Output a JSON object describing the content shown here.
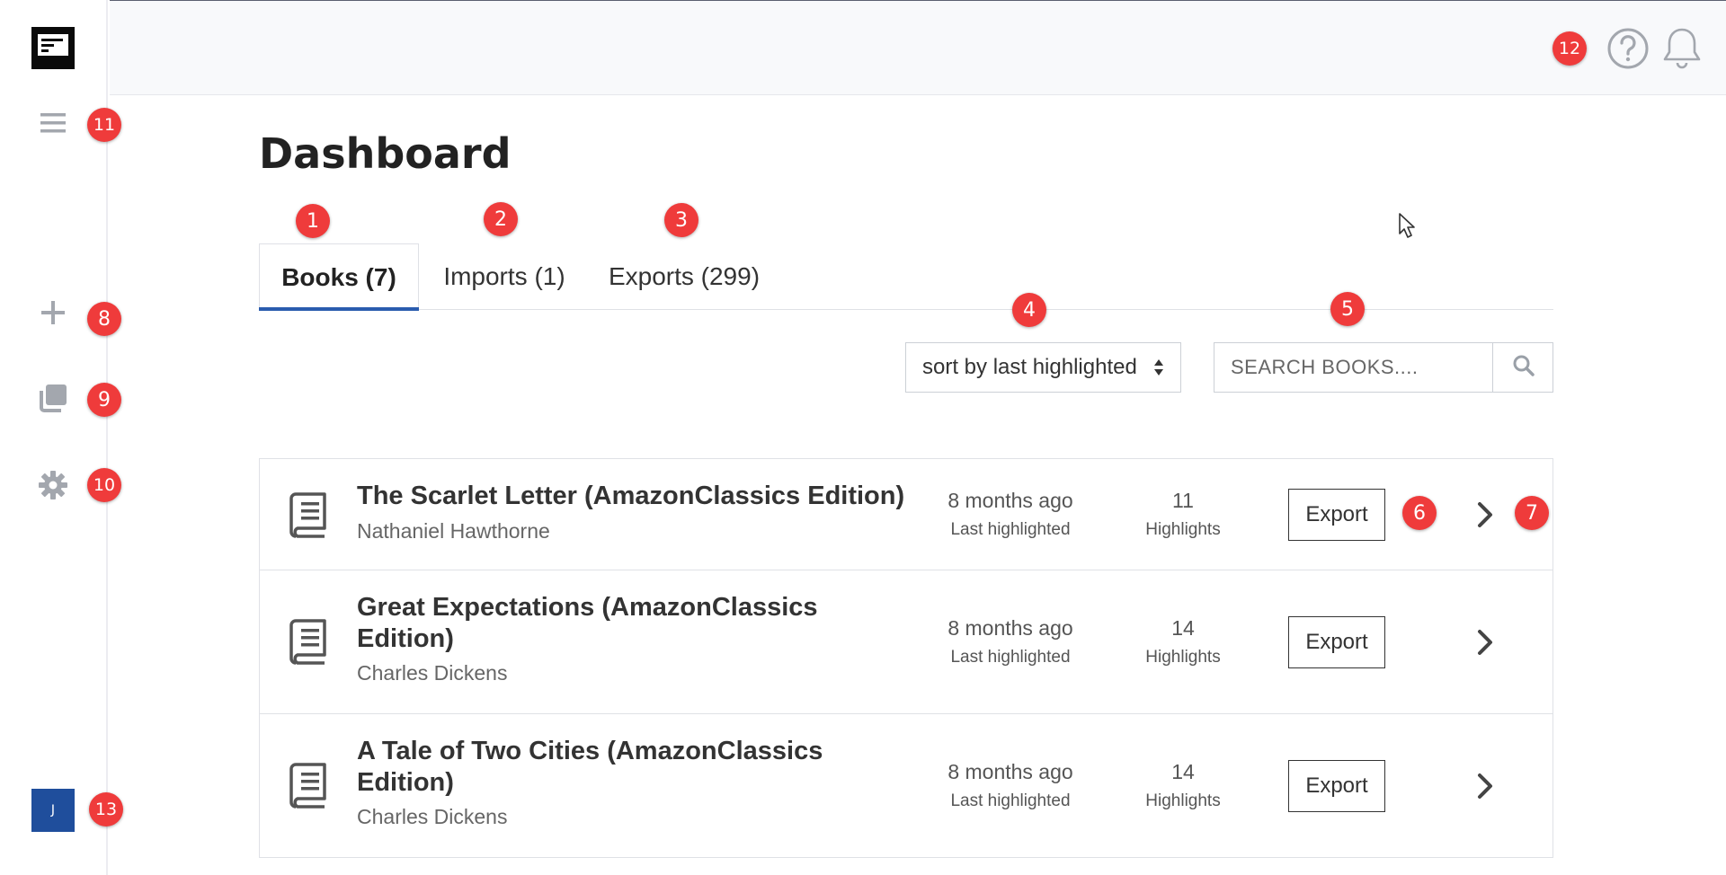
{
  "app": {
    "page_title": "Dashboard",
    "avatar_initial": "J"
  },
  "sidebar": {
    "items": [
      {
        "icon": "menu-icon"
      },
      {
        "icon": "plus-icon"
      },
      {
        "icon": "copy-icon"
      },
      {
        "icon": "gear-icon"
      }
    ]
  },
  "header": {
    "icons": [
      "help-icon",
      "bell-icon"
    ]
  },
  "tabs": [
    {
      "label": "Books (7)",
      "active": true
    },
    {
      "label": "Imports (1)",
      "active": false
    },
    {
      "label": "Exports (299)",
      "active": false
    }
  ],
  "controls": {
    "sort_label": "sort by last highlighted",
    "search_placeholder": "SEARCH BOOKS...."
  },
  "books": [
    {
      "title": "The Scarlet Letter (AmazonClassics Edition)",
      "author": "Nathaniel Hawthorne",
      "last_highlighted": "8 months ago",
      "last_highlighted_label": "Last highlighted",
      "highlights": "11",
      "highlights_label": "Highlights",
      "export_label": "Export"
    },
    {
      "title": "Great Expectations (AmazonClassics Edition)",
      "author": "Charles Dickens",
      "last_highlighted": "8 months ago",
      "last_highlighted_label": "Last highlighted",
      "highlights": "14",
      "highlights_label": "Highlights",
      "export_label": "Export"
    },
    {
      "title": "A Tale of Two Cities (AmazonClassics Edition)",
      "author": "Charles Dickens",
      "last_highlighted": "8 months ago",
      "last_highlighted_label": "Last highlighted",
      "highlights": "14",
      "highlights_label": "Highlights",
      "export_label": "Export"
    }
  ],
  "badges": [
    "1",
    "2",
    "3",
    "4",
    "5",
    "6",
    "7",
    "8",
    "9",
    "10",
    "11",
    "12",
    "13"
  ],
  "colors": {
    "accent": "#2a5cae",
    "badge": "#ef3b3b",
    "avatar": "#1f4e9c"
  }
}
